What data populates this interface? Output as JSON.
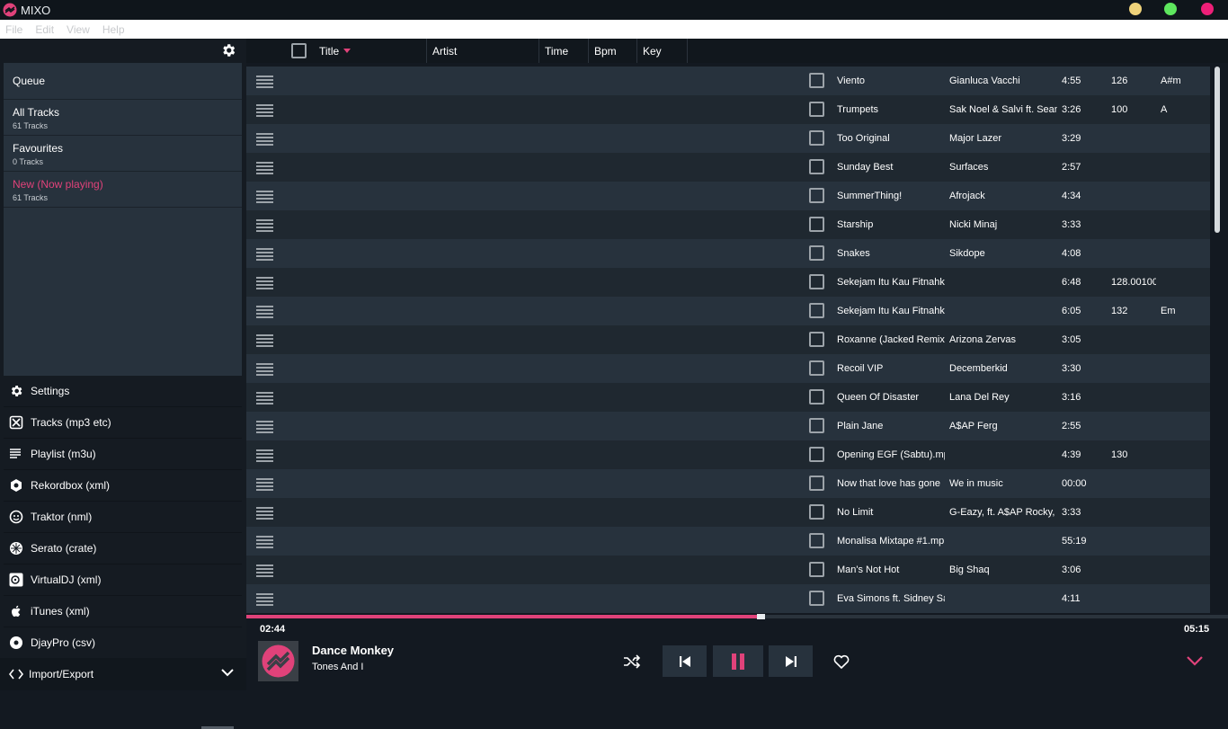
{
  "app": {
    "title": "MIXO"
  },
  "colors": {
    "accent": "#e0427a",
    "dot_yellow": "#efd27a",
    "dot_green": "#5ee65e",
    "dot_pink": "#ed1f78"
  },
  "menu": [
    "File",
    "Edit",
    "View",
    "Help"
  ],
  "sidebar": {
    "queue": "Queue",
    "playlists": [
      {
        "name": "All Tracks",
        "count": "61 Tracks",
        "active": false
      },
      {
        "name": "Favourites",
        "count": "0 Tracks",
        "active": false
      },
      {
        "name": "New (Now playing)",
        "count": "61 Tracks",
        "active": true
      }
    ],
    "nav": [
      {
        "label": "Settings",
        "icon": "gear-icon"
      },
      {
        "label": "Tracks (mp3 etc)",
        "icon": "tracks-icon"
      },
      {
        "label": "Playlist (m3u)",
        "icon": "playlist-icon"
      },
      {
        "label": "Rekordbox (xml)",
        "icon": "rekordbox-icon"
      },
      {
        "label": "Traktor (nml)",
        "icon": "traktor-icon"
      },
      {
        "label": "Serato (crate)",
        "icon": "serato-icon"
      },
      {
        "label": "VirtualDJ (xml)",
        "icon": "virtualdj-icon"
      },
      {
        "label": "iTunes (xml)",
        "icon": "apple-icon"
      },
      {
        "label": "DjayPro (csv)",
        "icon": "djaypro-icon"
      }
    ],
    "import_export": "Import/Export"
  },
  "columns": {
    "title": "Title",
    "artist": "Artist",
    "time": "Time",
    "bpm": "Bpm",
    "key": "Key"
  },
  "tracks": [
    {
      "title": "Viento",
      "artist": "Gianluca Vacchi",
      "time": "4:55",
      "bpm": "126",
      "key": "A#m"
    },
    {
      "title": "Trumpets",
      "artist": "Sak Noel & Salvi ft. Sean",
      "time": "3:26",
      "bpm": "100",
      "key": "A"
    },
    {
      "title": "Too Original",
      "artist": "Major Lazer",
      "time": "3:29",
      "bpm": "",
      "key": ""
    },
    {
      "title": "Sunday Best",
      "artist": "Surfaces",
      "time": "2:57",
      "bpm": "",
      "key": ""
    },
    {
      "title": "SummerThing!",
      "artist": "Afrojack",
      "time": "4:34",
      "bpm": "",
      "key": ""
    },
    {
      "title": "Starship",
      "artist": "Nicki Minaj",
      "time": "3:33",
      "bpm": "",
      "key": ""
    },
    {
      "title": "Snakes",
      "artist": "Sikdope",
      "time": "4:08",
      "bpm": "",
      "key": ""
    },
    {
      "title": "Sekejam Itu Kau Fitnahka",
      "artist": "",
      "time": "6:48",
      "bpm": "128.00100",
      "key": ""
    },
    {
      "title": "Sekejam Itu Kau Fitnahka",
      "artist": "",
      "time": "6:05",
      "bpm": "132",
      "key": "Em"
    },
    {
      "title": "Roxanne (Jacked Remix)",
      "artist": "Arizona Zervas",
      "time": "3:05",
      "bpm": "",
      "key": ""
    },
    {
      "title": "Recoil VIP",
      "artist": "Decemberkid",
      "time": "3:30",
      "bpm": "",
      "key": ""
    },
    {
      "title": "Queen Of Disaster",
      "artist": "Lana Del Rey",
      "time": "3:16",
      "bpm": "",
      "key": ""
    },
    {
      "title": "Plain Jane",
      "artist": "A$AP Ferg",
      "time": "2:55",
      "bpm": "",
      "key": ""
    },
    {
      "title": "Opening EGF (Sabtu).mp",
      "artist": "",
      "time": "4:39",
      "bpm": "130",
      "key": ""
    },
    {
      "title": "Now that love has gone",
      "artist": "We in music",
      "time": "00:00",
      "bpm": "",
      "key": ""
    },
    {
      "title": "No Limit",
      "artist": "G-Eazy, ft. A$AP Rocky,",
      "time": "3:33",
      "bpm": "",
      "key": ""
    },
    {
      "title": "Monalisa Mixtape #1.mp",
      "artist": "",
      "time": "55:19",
      "bpm": "",
      "key": ""
    },
    {
      "title": "Man's Not Hot",
      "artist": "Big Shaq",
      "time": "3:06",
      "bpm": "",
      "key": ""
    },
    {
      "title": "Eva Simons ft. Sidney Sa",
      "artist": "",
      "time": "4:11",
      "bpm": "",
      "key": ""
    }
  ],
  "player": {
    "song": "Dance Monkey",
    "artist": "Tones And I",
    "current_time": "02:44",
    "total_time": "05:15",
    "progress": 0.52
  }
}
